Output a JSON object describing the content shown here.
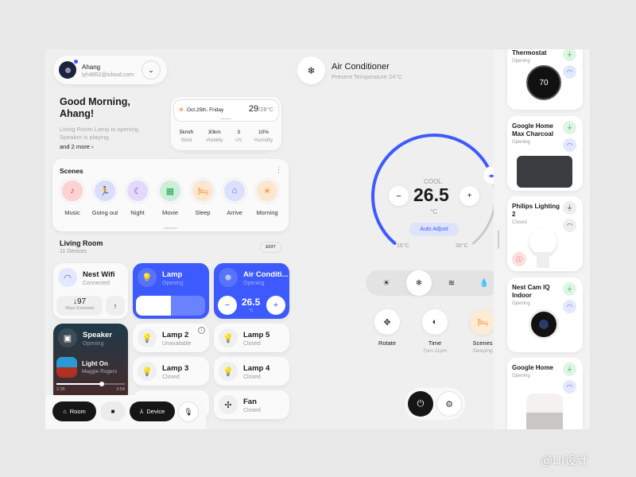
{
  "user": {
    "name": "Ahang",
    "email": "lyh4852@icloud.com"
  },
  "greeting": {
    "title_line1": "Good Morning,",
    "title_line2": "Ahang!",
    "line1": "Living Room Lamp is opening.",
    "line2": "Speaker is playing.",
    "more": "and 2 more ›"
  },
  "weather": {
    "date": "Oct.25th. Friday",
    "temp": "29",
    "temp_range": "/28°C",
    "stats": [
      {
        "value": "5km/h",
        "label": "Wind"
      },
      {
        "value": "30km",
        "label": "Visibility"
      },
      {
        "value": "3",
        "label": "UV"
      },
      {
        "value": "10%",
        "label": "Humidity"
      }
    ]
  },
  "scenes": {
    "title": "Scenes",
    "items": [
      {
        "label": "Music",
        "icon": "♪",
        "bg": "#fbd3d3",
        "fg": "#e53935"
      },
      {
        "label": "Going out",
        "icon": "🏃",
        "bg": "#d9defc",
        "fg": "#3d5afe"
      },
      {
        "label": "Night",
        "icon": "☾",
        "bg": "#e5d9fb",
        "fg": "#6a3de8"
      },
      {
        "label": "Movie",
        "icon": "▦",
        "bg": "#cdeed8",
        "fg": "#1faa4f"
      },
      {
        "label": "Sleep",
        "icon": "🛏",
        "bg": "#fde6cf",
        "fg": "#f58b1f"
      },
      {
        "label": "Arrive",
        "icon": "⌂",
        "bg": "#dbe1fd",
        "fg": "#3d5afe"
      },
      {
        "label": "Morning",
        "icon": "☀",
        "bg": "#fde7d1",
        "fg": "#f58b1f"
      }
    ]
  },
  "room": {
    "title": "Living Room",
    "count": "11 Devices",
    "edit": "EDIT"
  },
  "devices": {
    "wifi": {
      "name": "Nest Wifi",
      "status": "Connected",
      "speed": "↓97",
      "speed_label": "Mbps Download"
    },
    "lamp": {
      "name": "Lamp",
      "status": "Opening",
      "brightness_percent": 50
    },
    "ac": {
      "name": "Air Conditi...",
      "status": "Opening",
      "temp": "26.5",
      "unit": "°C"
    },
    "speaker": {
      "name": "Speaker",
      "status": "Opening",
      "song": "Light On",
      "artist": "Maggie Rogers",
      "elapsed": "2:35",
      "total": "3:54",
      "progress_percent": 66
    },
    "lamp2": {
      "name": "Lamp 2",
      "status": "Unavailable"
    },
    "lamp3": {
      "name": "Lamp 3",
      "status": "Closed"
    },
    "lamp4": {
      "name": "Lamp 4",
      "status": "Closed"
    },
    "lamp5": {
      "name": "Lamp 5",
      "status": "Closed"
    },
    "fan": {
      "name": "Fan",
      "status": "Closed"
    }
  },
  "nav": {
    "room": "Room",
    "device": "Device"
  },
  "aircon": {
    "title": "Air Conditioner",
    "subtitle": "Present Temperature 24°C",
    "mode": "COOL",
    "temp": "26.5",
    "unit": "°C",
    "auto": "Auto Adjust",
    "min_label": "16°C",
    "max_label": "30°C",
    "min": 16,
    "max": 30,
    "value": 26.5,
    "accent": "#3d5afe",
    "modes": [
      {
        "icon": "sun-icon",
        "glyph": "☀"
      },
      {
        "icon": "snowflake-icon",
        "glyph": "❄",
        "active": true
      },
      {
        "icon": "wind-icon",
        "glyph": "≋"
      },
      {
        "icon": "drop-icon",
        "glyph": "💧"
      }
    ],
    "actions": [
      {
        "label": "Rotate",
        "sub": "",
        "glyph": "✥"
      },
      {
        "label": "Time",
        "sub": "7pm-11pm",
        "glyph": "◐"
      },
      {
        "label": "Scenes",
        "sub": "Sleeping",
        "glyph": "🛏"
      }
    ]
  },
  "right_devices": [
    {
      "name": "Thermostat",
      "status": "Opening",
      "display": "70"
    },
    {
      "name": "Google Home Max Charcoal",
      "status": "Opening"
    },
    {
      "name": "Philips Lighting 2",
      "status": "Closed"
    },
    {
      "name": "Nest Cam IQ Indoor",
      "status": "Opening"
    },
    {
      "name": "Google Home",
      "status": "Opening"
    }
  ],
  "watermark": "@UI设计"
}
